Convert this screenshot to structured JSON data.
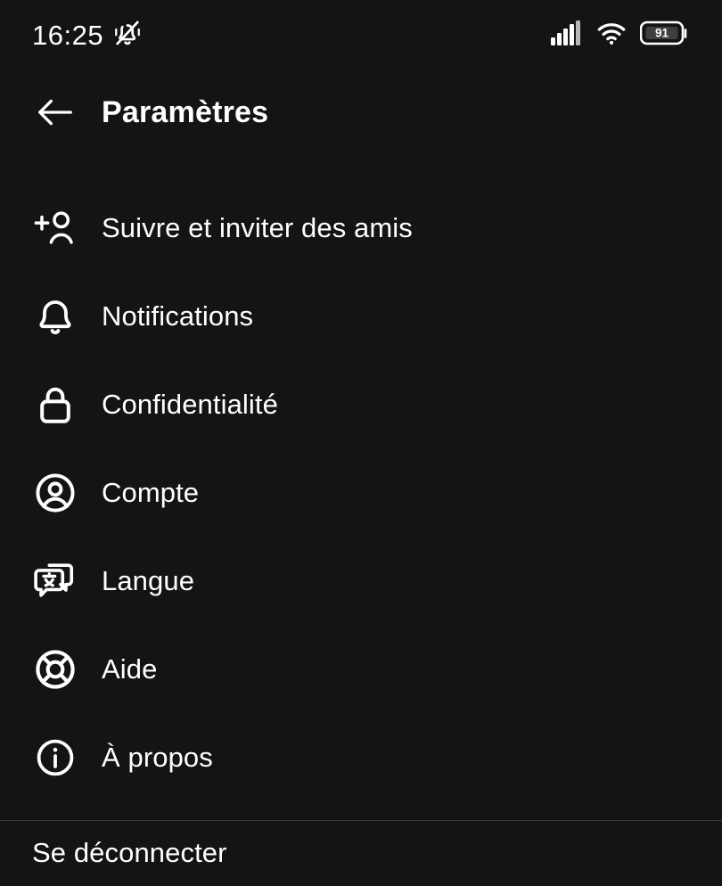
{
  "status_bar": {
    "time": "16:25",
    "silent_icon": "bell-muted-icon",
    "signal_icon": "cellular-signal-icon",
    "signal_bars": 4,
    "wifi_icon": "wifi-icon",
    "battery_icon": "battery-icon",
    "battery_level": "91"
  },
  "header": {
    "back_icon": "back-arrow-icon",
    "title": "Paramètres"
  },
  "settings": {
    "items": [
      {
        "id": "follow-invite-friends",
        "icon": "person-add-icon",
        "label": "Suivre et inviter des amis"
      },
      {
        "id": "notifications",
        "icon": "bell-icon",
        "label": "Notifications"
      },
      {
        "id": "privacy",
        "icon": "lock-icon",
        "label": "Confidentialité"
      },
      {
        "id": "account",
        "icon": "account-circle-icon",
        "label": "Compte"
      },
      {
        "id": "language",
        "icon": "translate-icon",
        "label": "Langue"
      },
      {
        "id": "help",
        "icon": "lifebuoy-icon",
        "label": "Aide"
      },
      {
        "id": "about",
        "icon": "info-circle-icon",
        "label": "À propos"
      }
    ]
  },
  "logout": {
    "label": "Se déconnecter"
  },
  "colors": {
    "background": "#141414",
    "text": "#ffffff",
    "divider": "#3a3a3a"
  }
}
